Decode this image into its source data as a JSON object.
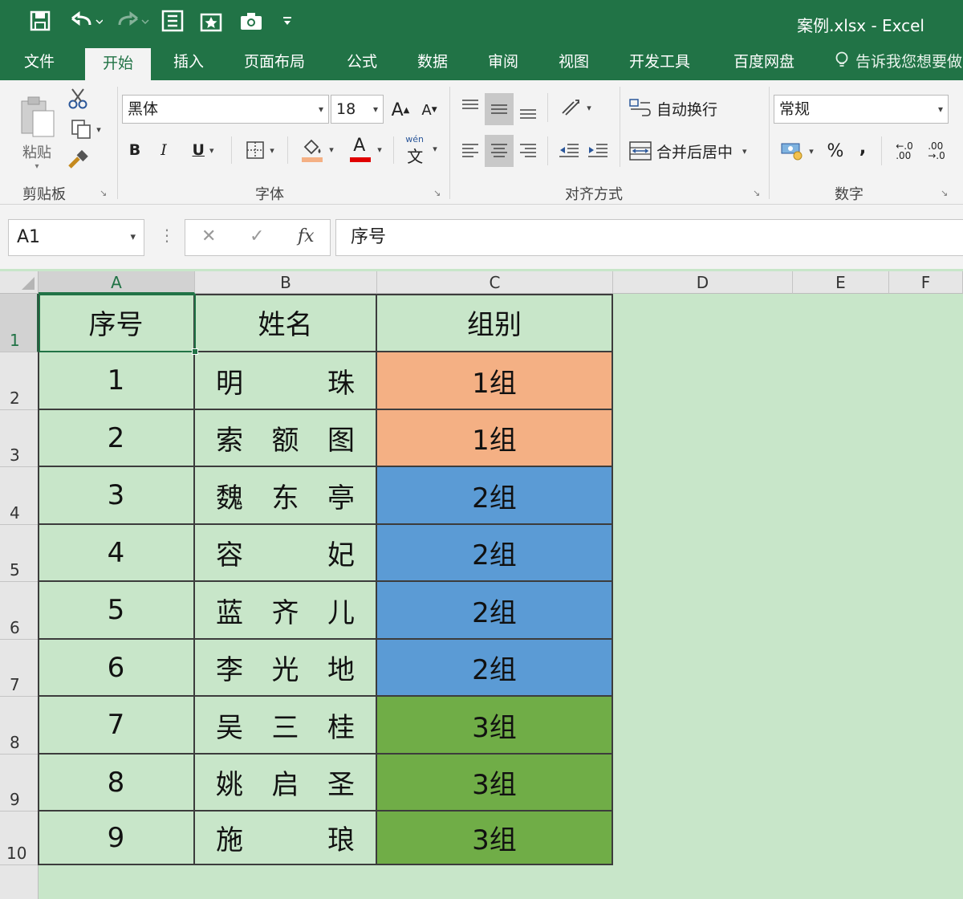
{
  "window": {
    "title": "案例.xlsx  -  Excel"
  },
  "ribbon_tabs": [
    "文件",
    "开始",
    "插入",
    "页面布局",
    "公式",
    "数据",
    "审阅",
    "视图",
    "开发工具",
    "百度网盘"
  ],
  "tell_me": "告诉我您想要做",
  "ribbon": {
    "clipboard": {
      "paste_label": "粘贴",
      "group_label": "剪贴板"
    },
    "font": {
      "font_name": "黑体",
      "font_size": "18",
      "bold": "B",
      "italic": "I",
      "underline": "U",
      "font_color_glyph": "A",
      "grow": "A",
      "shrink": "A",
      "wen": "wén",
      "wen_char": "文",
      "group_label": "字体"
    },
    "alignment": {
      "wrap_text": "自动换行",
      "merge_center": "合并后居中",
      "group_label": "对齐方式"
    },
    "number": {
      "format": "常规",
      "percent": "%",
      "comma": ",",
      "inc_decimal": "←.0\n.00",
      "dec_decimal": ".00\n→.0",
      "group_label": "数字"
    }
  },
  "formula_bar": {
    "name_box": "A1",
    "fx": "fx",
    "content": "序号"
  },
  "columns": [
    "A",
    "B",
    "C",
    "D",
    "E",
    "F"
  ],
  "rows": [
    "1",
    "2",
    "3",
    "4",
    "5",
    "6",
    "7",
    "8",
    "9",
    "10"
  ],
  "table": {
    "header": [
      "序号",
      "姓名",
      "组别"
    ],
    "records": [
      {
        "no": "1",
        "name": [
          "明",
          "",
          "珠"
        ],
        "group": "1组"
      },
      {
        "no": "2",
        "name": [
          "索",
          "额",
          "图"
        ],
        "group": "1组"
      },
      {
        "no": "3",
        "name": [
          "魏",
          "东",
          "亭"
        ],
        "group": "2组"
      },
      {
        "no": "4",
        "name": [
          "容",
          "",
          "妃"
        ],
        "group": "2组"
      },
      {
        "no": "5",
        "name": [
          "蓝",
          "齐",
          "儿"
        ],
        "group": "2组"
      },
      {
        "no": "6",
        "name": [
          "李",
          "光",
          "地"
        ],
        "group": "2组"
      },
      {
        "no": "7",
        "name": [
          "吴",
          "三",
          "桂"
        ],
        "group": "3组"
      },
      {
        "no": "8",
        "name": [
          "姚",
          "启",
          "圣"
        ],
        "group": "3组"
      },
      {
        "no": "9",
        "name": [
          "施",
          "",
          "琅"
        ],
        "group": "3组"
      }
    ]
  },
  "colors": {
    "excel_green": "#217346",
    "sheet_fill": "#c8e6c9",
    "group1": "#f4b084",
    "group2": "#5b9bd5",
    "group3": "#70ad47"
  }
}
